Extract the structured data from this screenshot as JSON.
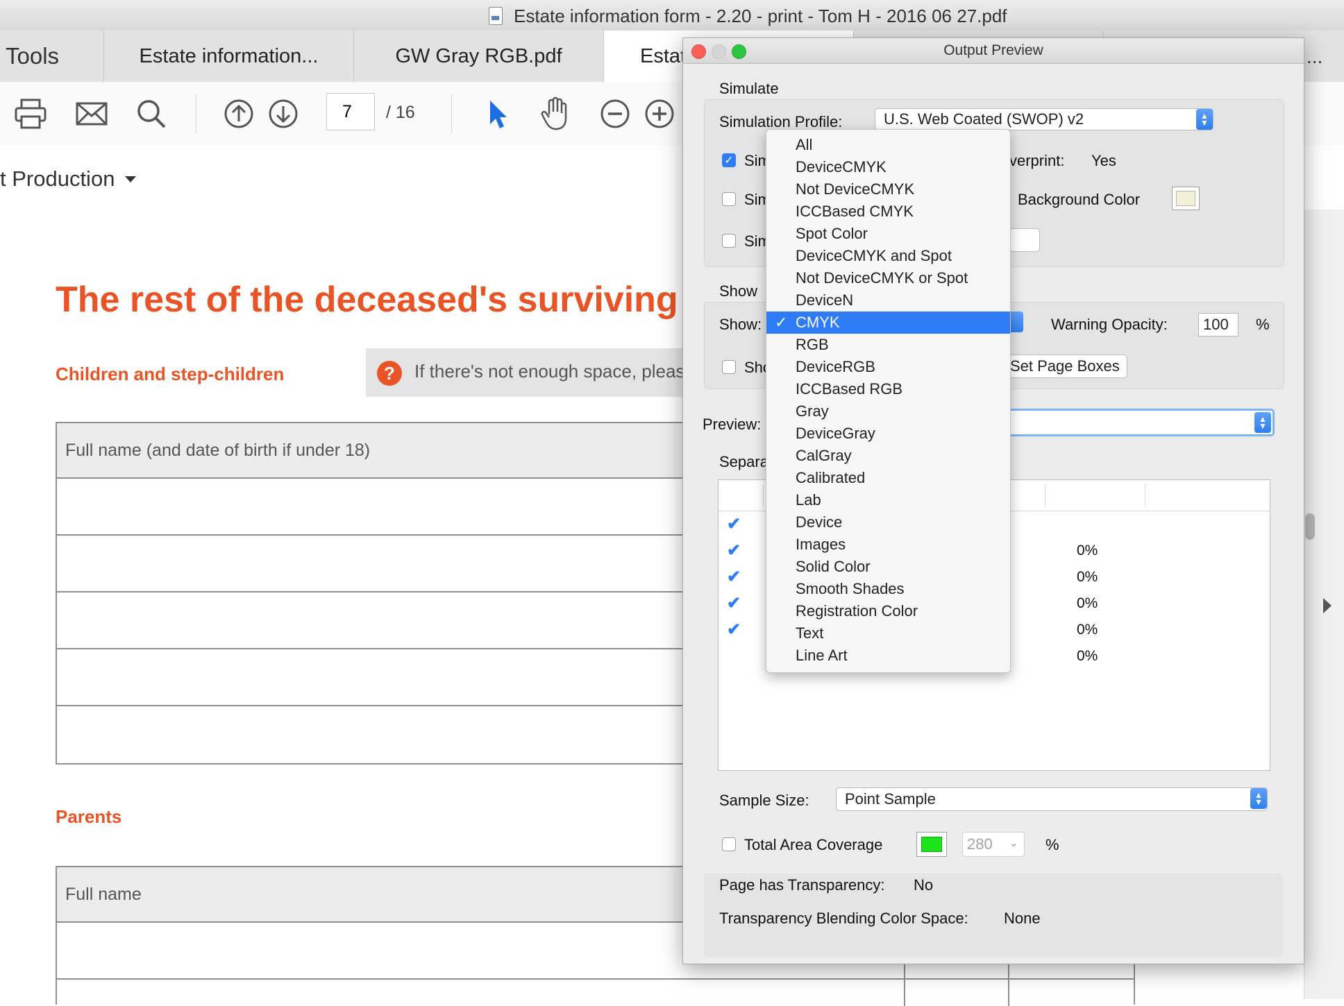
{
  "window": {
    "title": "Estate information form - 2.20 - print - Tom H - 2016 06 27.pdf"
  },
  "tabs": [
    {
      "label": "Tools"
    },
    {
      "label": "Estate information..."
    },
    {
      "label": "GW Gray RGB.pdf"
    },
    {
      "label": "Estat"
    },
    {
      "label": "..."
    }
  ],
  "toolbar": {
    "page_current": "7",
    "page_total": "/ 16"
  },
  "production_bar": {
    "label": "t Production"
  },
  "document": {
    "heading": "The rest of the deceased's surviving f",
    "section_children": "Children and step-children",
    "info_text": "If there's not enough space, pleas",
    "info_icon": "?",
    "table1_header": "Full name (and date of birth if under 18)",
    "section_parents": "Parents",
    "table2_header": "Full name"
  },
  "dialog": {
    "title": "Output Preview",
    "simulate_header": "Simulate",
    "simulation_profile_label": "Simulation Profile:",
    "simulation_profile_value": "U.S. Web Coated (SWOP) v2",
    "sim_check1": "Sim",
    "sim_check2": "Sim",
    "sim_check3": "Sim",
    "overprint_label": "verprint:",
    "overprint_value": "Yes",
    "background_color_label": "Background Color",
    "show_header": "Show",
    "show_label": "Show:",
    "warning_opacity_label": "Warning Opacity:",
    "warning_opacity_value": "100",
    "percent": "%",
    "show_check_label": "Sho",
    "set_page_boxes": "Set Page Boxes",
    "preview_label": "Preview:",
    "separations_label": "Separa",
    "separations": [
      {
        "color": "#ffffff",
        "value": ""
      },
      {
        "color": "#1fbcd2",
        "value": "0%"
      },
      {
        "color": "#d21e9b",
        "value": "0%"
      },
      {
        "color": "#e4c21c",
        "value": "0%"
      },
      {
        "color": "#111111",
        "value": "0%"
      },
      {
        "color": "",
        "value": "0%"
      }
    ],
    "sample_size_label": "Sample Size:",
    "sample_size_value": "Point Sample",
    "total_area_label": "Total Area Coverage",
    "total_area_value": "280",
    "total_area_color": "#1de31d",
    "transparency_label": "Page has Transparency:",
    "transparency_value": "No",
    "blending_label": "Transparency Blending Color Space:",
    "blending_value": "None"
  },
  "dropdown": {
    "selected_index": 8,
    "items": [
      "All",
      "DeviceCMYK",
      "Not DeviceCMYK",
      "ICCBased CMYK",
      "Spot Color",
      "DeviceCMYK and Spot",
      "Not DeviceCMYK or Spot",
      "DeviceN",
      "CMYK",
      "RGB",
      "DeviceRGB",
      "ICCBased RGB",
      "Gray",
      "DeviceGray",
      "CalGray",
      "Calibrated",
      "Lab",
      "Device",
      "Images",
      "Solid Color",
      "Smooth Shades",
      "Registration Color",
      "Text",
      "Line Art"
    ]
  },
  "colors": {
    "accent": "#e95426",
    "selection": "#2f7df6"
  }
}
